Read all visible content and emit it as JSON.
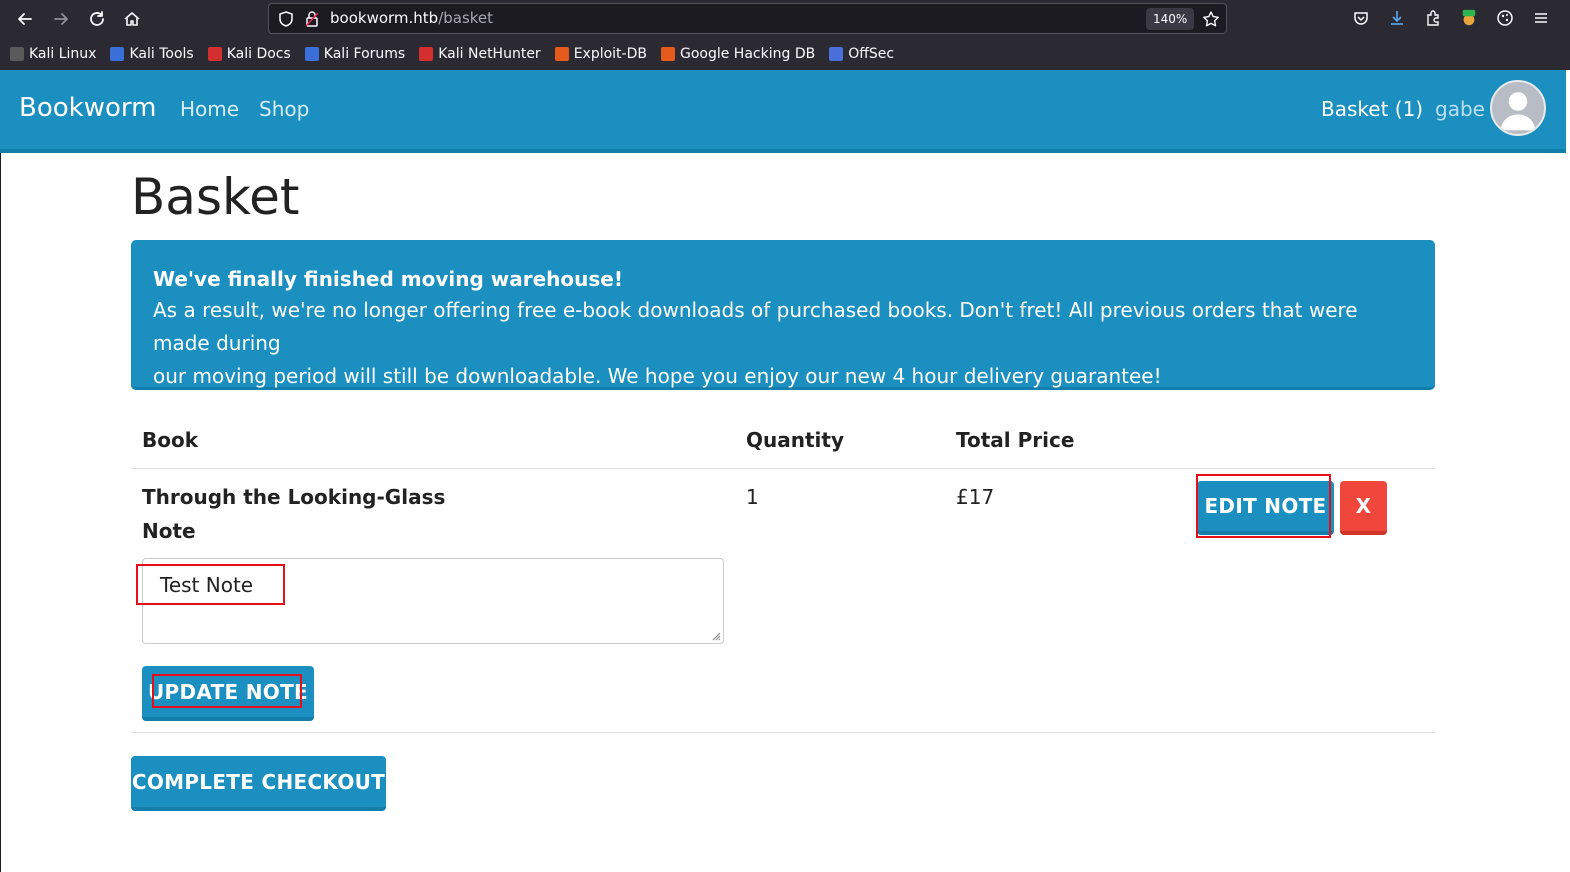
{
  "browser": {
    "url_host": "bookworm.htb",
    "url_path": "/basket",
    "zoom": "140%",
    "bookmarks": [
      {
        "label": "Kali Linux",
        "color": "#2a2a2a"
      },
      {
        "label": "Kali Tools",
        "color": "#3b6fd8"
      },
      {
        "label": "Kali Docs",
        "color": "#d32f2f"
      },
      {
        "label": "Kali Forums",
        "color": "#3b6fd8"
      },
      {
        "label": "Kali NetHunter",
        "color": "#d32f2f"
      },
      {
        "label": "Exploit-DB",
        "color": "#e65a1e"
      },
      {
        "label": "Google Hacking DB",
        "color": "#e65a1e"
      },
      {
        "label": "OffSec",
        "color": "#4a6fd8"
      }
    ]
  },
  "navbar": {
    "brand": "Bookworm",
    "links": [
      "Home",
      "Shop"
    ],
    "basket": "Basket (1)",
    "user": "gabe"
  },
  "page": {
    "title": "Basket",
    "alert": {
      "title": "We've finally finished moving warehouse!",
      "line1": "As a result, we're no longer offering free e-book downloads of purchased books. Don't fret! All previous orders that were made during",
      "line2": "our moving period will still be downloadable. We hope you enjoy our new 4 hour delivery guarantee!"
    },
    "table": {
      "headers": [
        "Book",
        "Quantity",
        "Total Price"
      ],
      "rows": [
        {
          "book": "Through the Looking-Glass",
          "note_label": "Note",
          "note_value": "Test Note",
          "quantity": "1",
          "price": "£17",
          "edit_label": "EDIT NOTE",
          "remove_label": "X",
          "update_label": "UPDATE NOTE"
        }
      ]
    },
    "checkout_label": "COMPLETE CHECKOUT"
  },
  "colors": {
    "primary": "#1a8fc0",
    "danger": "#f0463c",
    "annotation": "#e3101a"
  }
}
